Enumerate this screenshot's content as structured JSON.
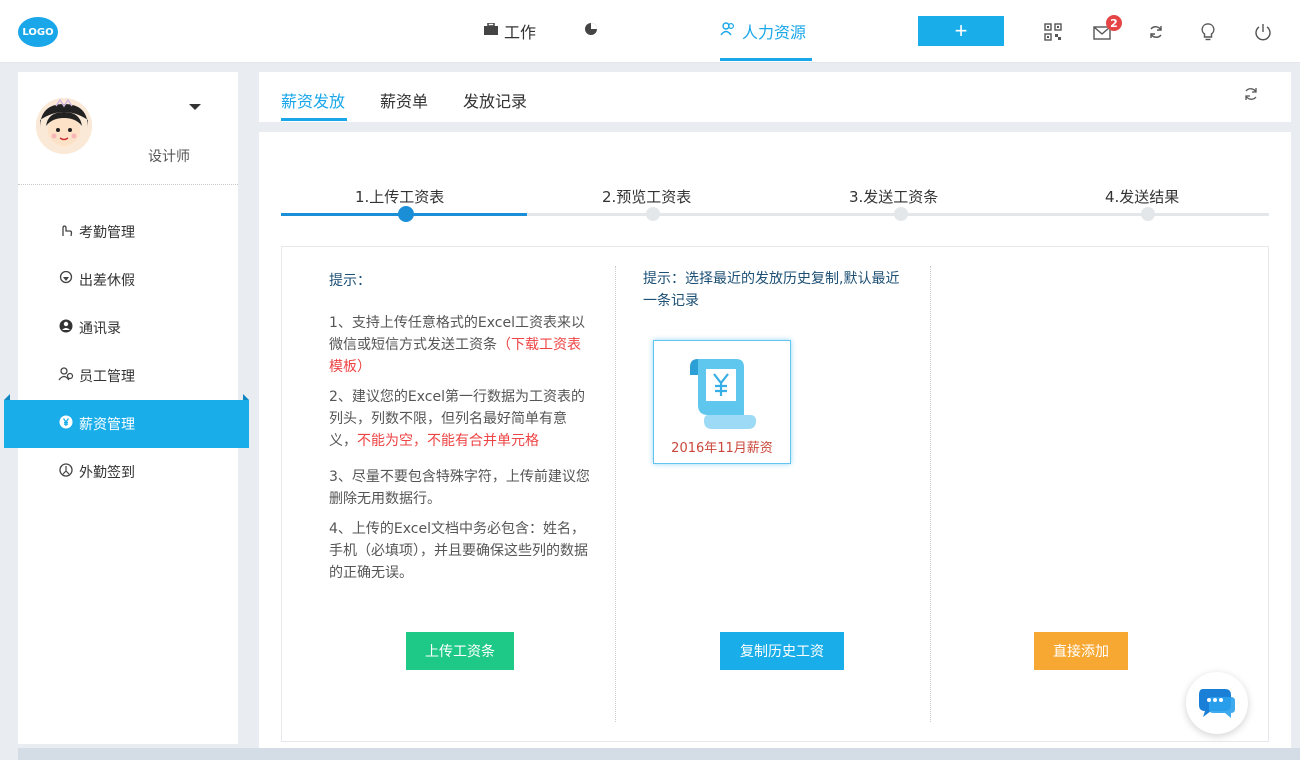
{
  "topbar": {
    "logo": "LOGO",
    "nav": [
      {
        "label": "工作",
        "icon": "briefcase-icon"
      },
      {
        "label": "",
        "icon": "pie-chart-icon"
      },
      {
        "label": "人力资源",
        "icon": "people-icon"
      }
    ],
    "add_label": "+",
    "mail_badge": "2",
    "icons": [
      "qrcode-icon",
      "mail-icon",
      "refresh-icon",
      "lightbulb-icon",
      "power-icon"
    ]
  },
  "sidebar": {
    "user_role": "设计师",
    "items": [
      {
        "label": "考勤管理",
        "icon": "hand-icon"
      },
      {
        "label": "出差休假",
        "icon": "location-icon"
      },
      {
        "label": "通讯录",
        "icon": "contact-icon"
      },
      {
        "label": "员工管理",
        "icon": "staff-icon"
      },
      {
        "label": "薪资管理",
        "icon": "yen-icon"
      },
      {
        "label": "外勤签到",
        "icon": "checkin-icon"
      }
    ],
    "active_index": 4
  },
  "tabs": [
    "薪资发放",
    "薪资单",
    "发放记录"
  ],
  "steps": [
    "1.上传工资表",
    "2.预览工资表",
    "3.发送工资条",
    "4.发送结果"
  ],
  "current_step": 1,
  "upload": {
    "title": "提示：",
    "tip1_prefix": "1、支持上传任意格式的Excel工资表来以微信或短信方式发送工资条",
    "tip1_link": "（下载工资表模板）",
    "tip2_prefix": "2、建议您的Excel第一行数据为工资表的列头，列数不限，但列名最好简单有意义，",
    "tip2_red": "不能为空，不能有合并单元格",
    "tip3": "3、尽量不要包含特殊字符，上传前建议您删除无用数据行。",
    "tip4": "4、上传的Excel文档中务必包含：姓名，手机（必填项），并且要确保这些列的数据的正确无误。",
    "button": "上传工资条"
  },
  "history": {
    "tip": "提示：选择最近的发放历史复制,默认最近一条记录",
    "card_label": "2016年11月薪资",
    "button": "复制历史工资"
  },
  "direct": {
    "button": "直接添加"
  },
  "colors": {
    "accent": "#1aa7ea",
    "green": "#1ec987",
    "orange": "#f7a833",
    "red": "#e44444"
  }
}
